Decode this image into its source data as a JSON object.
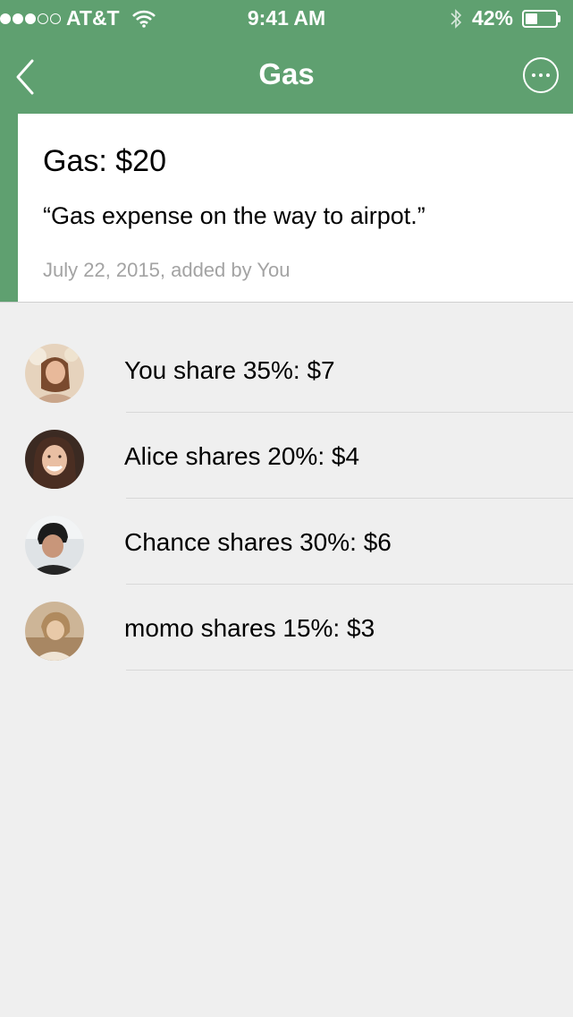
{
  "status_bar": {
    "carrier": "AT&T",
    "time": "9:41 AM",
    "battery": "42%",
    "battery_level": 0.42,
    "signal_bars_full": 3,
    "signal_bars_total": 5
  },
  "nav": {
    "title": "Gas",
    "back_icon": "chevron-left-icon",
    "more_icon": "more-horizontal-icon"
  },
  "expense": {
    "title": "Gas: $20",
    "description": "“Gas expense on the way to airpot.”",
    "meta": "July 22, 2015, added by You"
  },
  "shares": [
    {
      "text": "You share 35%: $7",
      "avatar": "avatar-you"
    },
    {
      "text": "Alice shares 20%: $4",
      "avatar": "avatar-alice"
    },
    {
      "text": "Chance shares 30%: $6",
      "avatar": "avatar-chance"
    },
    {
      "text": "momo shares 15%: $3",
      "avatar": "avatar-momo"
    }
  ],
  "colors": {
    "header": "#5fa070",
    "background": "#efefef",
    "meta_text": "#a3a3a3"
  }
}
